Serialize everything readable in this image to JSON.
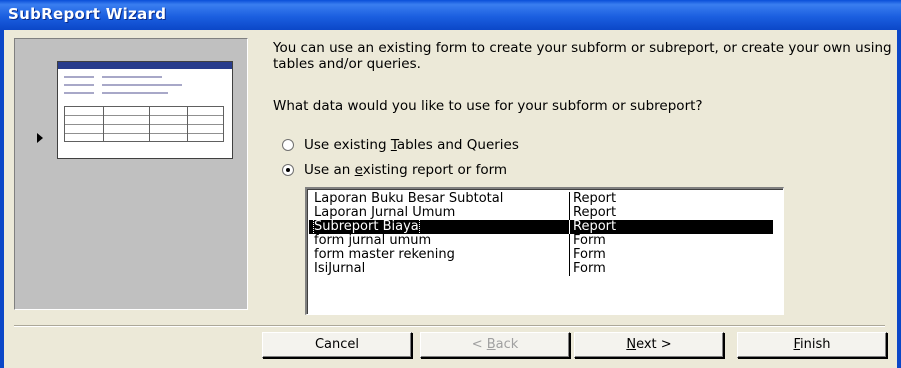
{
  "window": {
    "title": "SubReport Wizard"
  },
  "intro_text": "You can use an existing form to create your subform or subreport, or create your own using tables and/or queries.",
  "question": "What data would you like to use for your subform or subreport?",
  "options": [
    {
      "pre": "Use existing ",
      "key": "T",
      "post": "ables and Queries",
      "checked": false
    },
    {
      "pre": "Use an ",
      "key": "e",
      "post": "xisting report or form",
      "checked": true
    }
  ],
  "list": {
    "items": [
      {
        "name": "Laporan Buku Besar Subtotal",
        "type": "Report",
        "selected": false
      },
      {
        "name": "Laporan Jurnal Umum",
        "type": "Report",
        "selected": false
      },
      {
        "name": "Subreport Biaya",
        "type": "Report",
        "selected": true
      },
      {
        "name": "form jurnal umum",
        "type": "Form",
        "selected": false
      },
      {
        "name": "form master rekening",
        "type": "Form",
        "selected": false
      },
      {
        "name": "IsiJurnal",
        "type": "Form",
        "selected": false
      }
    ]
  },
  "buttons": {
    "cancel": {
      "label": "Cancel"
    },
    "back": {
      "pre": "< ",
      "key": "B",
      "post": "ack",
      "enabled": false
    },
    "next": {
      "key": "N",
      "post": "ext >",
      "enabled": true
    },
    "finish": {
      "key": "F",
      "post": "inish",
      "enabled": true
    }
  }
}
